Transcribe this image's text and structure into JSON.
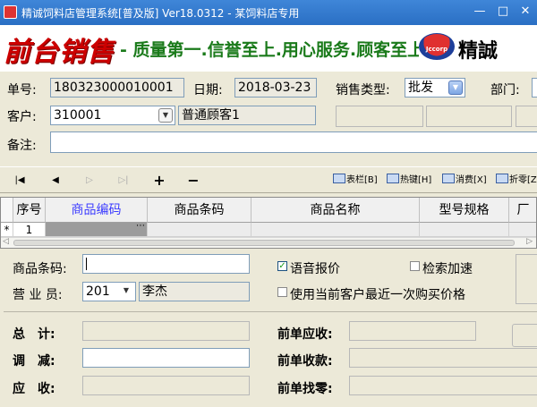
{
  "window": {
    "title": "精诚饲料店管理系统[普及版] Ver18.0312 - 某饲料店专用",
    "minimize": "—",
    "maximize": "□",
    "close": "✕"
  },
  "banner": {
    "logo_text": "前台销售",
    "slogan": "- 质量第一.信誉至上.用心服务.顾客至上",
    "brand_logo_text": "Jccorp",
    "brand_name": "精誠"
  },
  "form": {
    "order_no_label": "单号:",
    "order_no": "180323000010001",
    "date_label": "日期:",
    "date": "2018-03-23",
    "sale_type_label": "销售类型:",
    "sale_type": "批发",
    "dept_label": "部门:",
    "customer_label": "客户:",
    "customer_code": "310001",
    "customer_name": "普通顾客1",
    "remark_label": "备注:",
    "remark": ""
  },
  "toolbar": {
    "first": "|◀",
    "prev": "◀",
    "next": "▷",
    "last": "▷|",
    "add": "+",
    "remove": "−",
    "columns": "表栏[B]",
    "hotkeys": "热键[H]",
    "clear": "消费[X]",
    "discount": "折零[Z]"
  },
  "grid": {
    "columns": [
      "序号",
      "商品编码",
      "商品条码",
      "商品名称",
      "型号规格",
      "厂"
    ],
    "rows": [
      {
        "marker": "*",
        "seq": "1",
        "code": "",
        "barcode": "",
        "name": "",
        "spec": ""
      }
    ]
  },
  "entry": {
    "barcode_label": "商品条码:",
    "barcode": "",
    "voice_quote_label": "语音报价",
    "voice_quote_checked": true,
    "search_accel_label": "检索加速",
    "search_accel_checked": false,
    "salesman_label": "营 业 员:",
    "salesman_code": "201",
    "salesman_name": "李杰",
    "last_price_label": "使用当前客户最近一次购买价格",
    "last_price_checked": false
  },
  "totals": {
    "total_label": "总　计:",
    "adjust_label": "调　减:",
    "due_label": "应　收:",
    "prev_due_label": "前单应收:",
    "prev_paid_label": "前单收款:",
    "prev_change_label": "前单找零:"
  }
}
